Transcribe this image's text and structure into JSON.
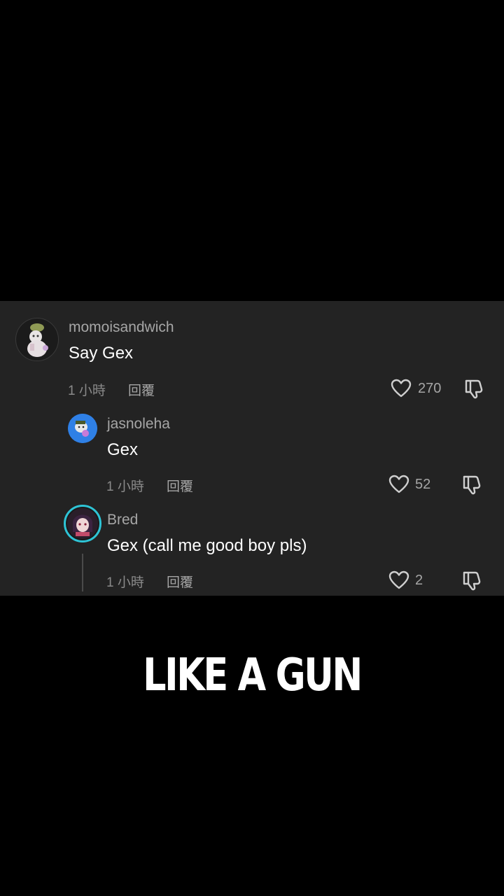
{
  "comments": [
    {
      "username": "momoisandwich",
      "text": "Say Gex",
      "time": "1 小時",
      "reply_label": "回覆",
      "likes": "270",
      "avatar": "sticker-character-avatar"
    },
    {
      "username": "jasnoleha",
      "text": "Gex",
      "time": "1 小時",
      "reply_label": "回覆",
      "likes": "52",
      "avatar": "blue-character-avatar"
    },
    {
      "username": "Bred",
      "text": "Gex (call me good boy pls)",
      "time": "1 小時",
      "reply_label": "回覆",
      "likes": "2",
      "avatar": "anime-avatar-with-ring"
    }
  ],
  "caption": "LIKE A GUN",
  "colors": {
    "background": "#000000",
    "panel": "#232323",
    "username": "#a6a6a6",
    "meta": "#8a8a8a",
    "avatar_ring": "#2ec4d6"
  },
  "icons": {
    "like": "heart-outline-icon",
    "dislike": "thumbs-down-icon"
  }
}
